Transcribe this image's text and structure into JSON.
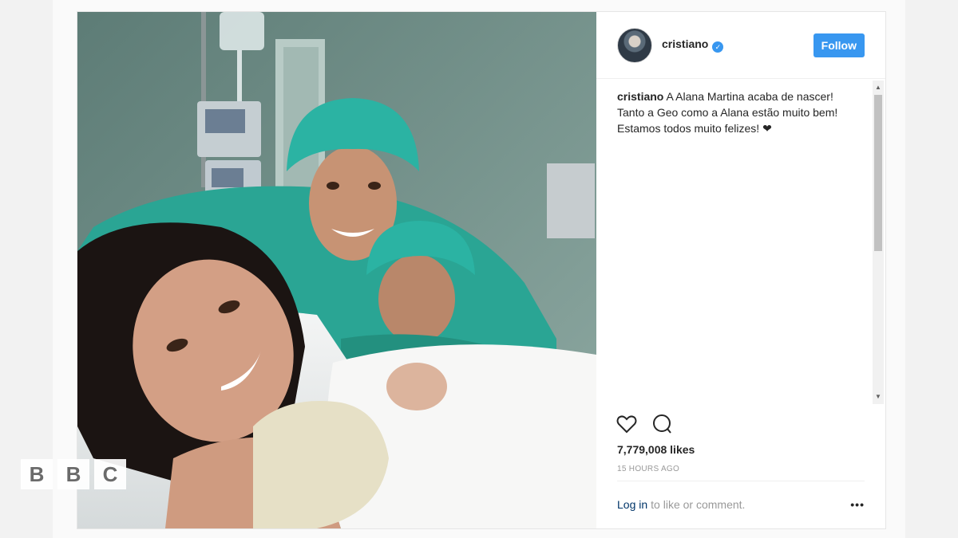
{
  "post": {
    "username": "cristiano",
    "verified_icon": "verified-badge-icon",
    "follow_label": "Follow",
    "caption_user": "cristiano",
    "caption_text": "A Alana Martina acaba de nascer! Tanto a Geo como a Alana estão muito bem! Estamos todos muito felizes! ❤",
    "likes": "7,779,008 likes",
    "time": "15 HOURS AGO",
    "login_label": "Log in",
    "login_suffix": "to like or comment.",
    "more_label": "•••"
  },
  "watermark": {
    "letters": [
      "B",
      "B",
      "C"
    ]
  },
  "colors": {
    "accent": "#3897f0",
    "scrubs": "#2aa594",
    "wall": "#6e8f88"
  }
}
